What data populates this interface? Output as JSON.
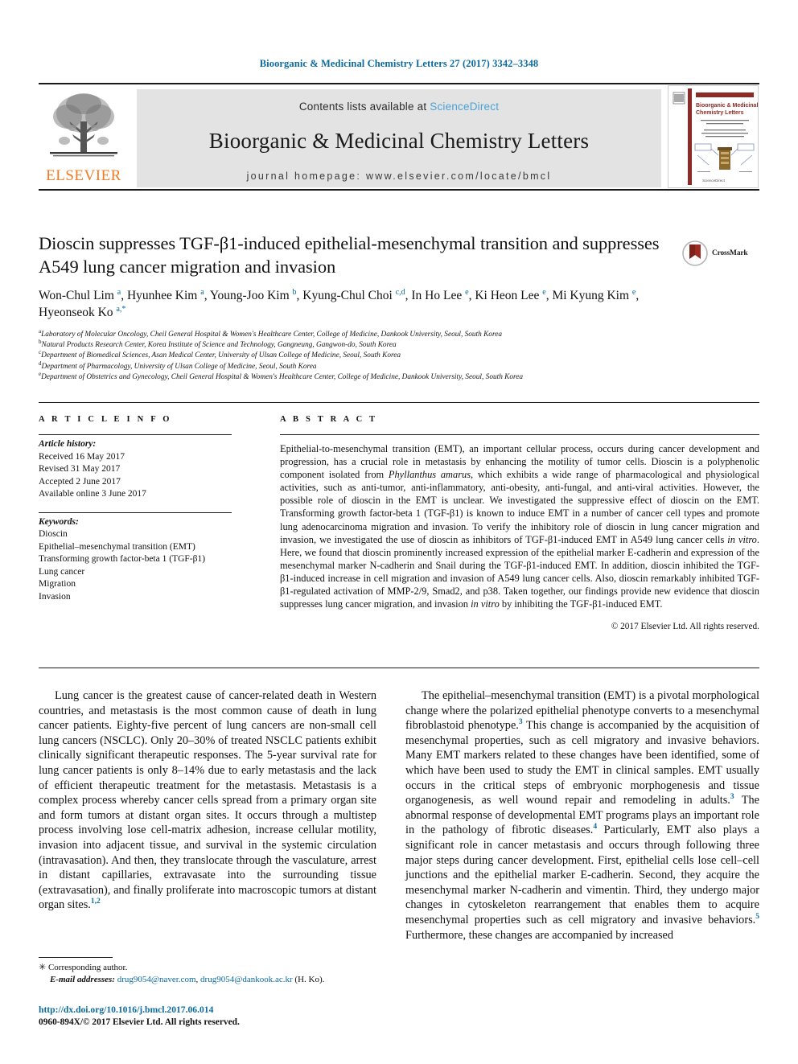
{
  "running_head": "Bioorganic & Medicinal Chemistry Letters 27 (2017) 3342–3348",
  "masthead": {
    "publisher": "ELSEVIER",
    "contents_prefix": "Contents lists available at ",
    "contents_link": "ScienceDirect",
    "journal_title": "Bioorganic & Medicinal Chemistry Letters",
    "homepage": "journal homepage: www.elsevier.com/locate/bmcl",
    "cover_title": "Bioorganic & Medicinal Chemistry Letters",
    "cover_subtitle": "The Tetrahedron Journal for Research at the Interface of Chemistry and Biology",
    "cover_footer": "ScienceDirect"
  },
  "crossmark": {
    "label": "CrossMark"
  },
  "title": "Dioscin suppresses TGF-β1-induced epithelial-mesenchymal transition and suppresses A549 lung cancer migration and invasion",
  "authors_html": "Won-Chul Lim <sup>a</sup>, Hyunhee Kim <sup>a</sup>, Young-Joo Kim <sup>b</sup>, Kyung-Chul Choi <sup>c,d</sup>, In Ho Lee <sup>e</sup>, Ki Heon Lee <sup>e</sup>, Mi Kyung Kim <sup>e</sup>, Hyeonseok Ko <sup>a,*</sup>",
  "affiliations": [
    {
      "mark": "a",
      "text": "Laboratory of Molecular Oncology, Cheil General Hospital & Women's Healthcare Center, College of Medicine, Dankook University, Seoul, South Korea"
    },
    {
      "mark": "b",
      "text": "Natural Products Research Center, Korea Institute of Science and Technology, Gangneung, Gangwon-do, South Korea"
    },
    {
      "mark": "c",
      "text": "Department of Biomedical Sciences, Asan Medical Center, University of Ulsan College of Medicine, Seoul, South Korea"
    },
    {
      "mark": "d",
      "text": "Department of Pharmacology, University of Ulsan College of Medicine, Seoul, South Korea"
    },
    {
      "mark": "e",
      "text": "Department of Obstetrics and Gynecology, Cheil General Hospital & Women's Healthcare Center, College of Medicine, Dankook University, Seoul, South Korea"
    }
  ],
  "article_info": {
    "heading": "A R T I C L E  I N F O",
    "history_label": "Article history:",
    "history": [
      "Received 16 May 2017",
      "Revised 31 May 2017",
      "Accepted 2 June 2017",
      "Available online 3 June 2017"
    ],
    "keywords_label": "Keywords:",
    "keywords": [
      "Dioscin",
      "Epithelial–mesenchymal transition (EMT)",
      "Transforming growth factor-beta 1 (TGF-β1)",
      "Lung cancer",
      "Migration",
      "Invasion"
    ]
  },
  "abstract": {
    "heading": "A B S T R A C T",
    "body_html": "Epithelial-to-mesenchymal transition (EMT), an important cellular process, occurs during cancer development and progression, has a crucial role in metastasis by enhancing the motility of tumor cells. Dioscin is a polyphenolic component isolated from <i>Phyllanthus amarus</i>, which exhibits a wide range of pharmacological and physiological activities, such as anti-tumor, anti-inflammatory, anti-obesity, anti-fungal, and anti-viral activities. However, the possible role of dioscin in the EMT is unclear. We investigated the suppressive effect of dioscin on the EMT. Transforming growth factor-beta 1 (TGF-β1) is known to induce EMT in a number of cancer cell types and promote lung adenocarcinoma migration and invasion. To verify the inhibitory role of dioscin in lung cancer migration and invasion, we investigated the use of dioscin as inhibitors of TGF-β1-induced EMT in A549 lung cancer cells <i>in vitro</i>. Here, we found that dioscin prominently increased expression of the epithelial marker E-cadherin and expression of the mesenchymal marker N-cadherin and Snail during the TGF-β1-induced EMT. In addition, dioscin inhibited the TGF-β1-induced increase in cell migration and invasion of A549 lung cancer cells. Also, dioscin remarkably inhibited TGF-β1-regulated activation of MMP-2/9, Smad2, and p38. Taken together, our findings provide new evidence that dioscin suppresses lung cancer migration, and invasion <i>in vitro</i> by inhibiting the TGF-β1-induced EMT.",
    "copyright": "© 2017 Elsevier Ltd. All rights reserved."
  },
  "body": {
    "left_paragraph_html": "Lung cancer is the greatest cause of cancer-related death in Western countries, and metastasis is the most common cause of death in lung cancer patients. Eighty-five percent of lung cancers are non-small cell lung cancers (NSCLC). Only 20–30% of treated NSCLC patients exhibit clinically significant therapeutic responses. The 5-year survival rate for lung cancer patients is only 8–14% due to early metastasis and the lack of efficient therapeutic treatment for the metastasis. Metastasis is a complex process whereby cancer cells spread from a primary organ site and form tumors at distant organ sites. It occurs through a multistep process involving lose cell-matrix adhesion, increase cellular motility, invasion into adjacent tissue, and survival in the systemic circulation (intravasation). And then, they translocate through the vasculature, arrest in distant capillaries, extravasate into the surrounding tissue (extravasation), and finally proliferate into macroscopic tumors at distant organ sites.<sup class=\"ref\">1,2</sup>",
    "right_paragraph_html": "The epithelial–mesenchymal transition (EMT) is a pivotal morphological change where the polarized epithelial phenotype converts to a mesenchymal fibroblastoid phenotype.<sup class=\"ref\">3</sup> This change is accompanied by the acquisition of mesenchymal properties, such as cell migratory and invasive behaviors. Many EMT markers related to these changes have been identified, some of which have been used to study the EMT in clinical samples. EMT usually occurs in the critical steps of embryonic morphogenesis and tissue organogenesis, as well wound repair and remodeling in adults.<sup class=\"ref\">3</sup> The abnormal response of developmental EMT programs plays an important role in the pathology of fibrotic diseases.<sup class=\"ref\">4</sup> Particularly, EMT also plays a significant role in cancer metastasis and occurs through following three major steps during cancer development. First, epithelial cells lose cell–cell junctions and the epithelial marker E-cadherin. Second, they acquire the mesenchymal marker N-cadherin and vimentin. Third, they undergo major changes in cytoskeleton rearrangement that enables them to acquire mesenchymal properties such as cell migratory and invasive behaviors.<sup class=\"ref\">5</sup> Furthermore, these changes are accompanied by increased"
  },
  "footnote": {
    "corresponding": "Corresponding author.",
    "email_label": "E-mail addresses:",
    "email_1": "drug9054@naver.com",
    "email_sep": ", ",
    "email_2": "drug9054@dankook.ac.kr",
    "email_suffix": " (H. Ko)."
  },
  "doi": {
    "url": "http://dx.doi.org/10.1016/j.bmcl.2017.06.014",
    "issn_line": "0960-894X/© 2017 Elsevier Ltd. All rights reserved."
  },
  "colors": {
    "link_blue": "#0b6ba0",
    "sciencedirect_blue": "#4aa3d6",
    "elsevier_orange": "#f47b20",
    "gray_box": "#e3e3e3",
    "crossmark_red": "#9c2b23"
  }
}
